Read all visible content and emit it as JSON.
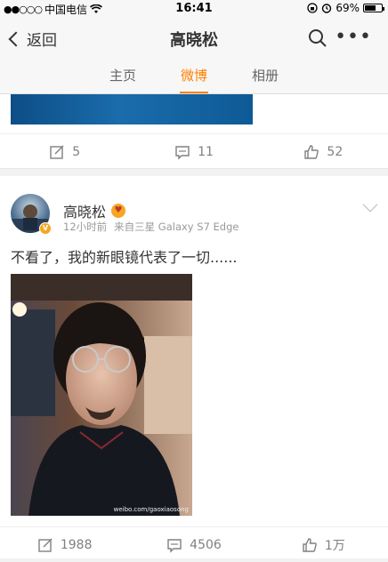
{
  "status_bar": {
    "signal": "●●○○○",
    "carrier": "中国电信",
    "time": "16:41",
    "battery": "69%",
    "battery_level": 0.69
  },
  "nav": {
    "back_label": "返回",
    "title": "高晓松"
  },
  "tabs": [
    {
      "label": "主页",
      "active": false
    },
    {
      "label": "微博",
      "active": true
    },
    {
      "label": "相册",
      "active": false
    }
  ],
  "previous_post": {
    "image_caption": "",
    "repost_count": "5",
    "comment_count": "11",
    "like_count": "52"
  },
  "post": {
    "username": "高晓松",
    "time": "12小时前",
    "source": "来自三星 Galaxy S7 Edge",
    "text": "不看了，我的新眼镜代表了一切......",
    "watermark": "weibo.com/gaoxiaosong",
    "repost_count": "1988",
    "comment_count": "4506",
    "like_count": "1万"
  },
  "colors": {
    "accent": "#ff8200",
    "verified": "#f5a623"
  },
  "icons": [
    "back-chevron-icon",
    "search-icon",
    "more-icon",
    "repost-icon",
    "comment-icon",
    "like-icon",
    "dropdown-icon",
    "verified-icon"
  ]
}
